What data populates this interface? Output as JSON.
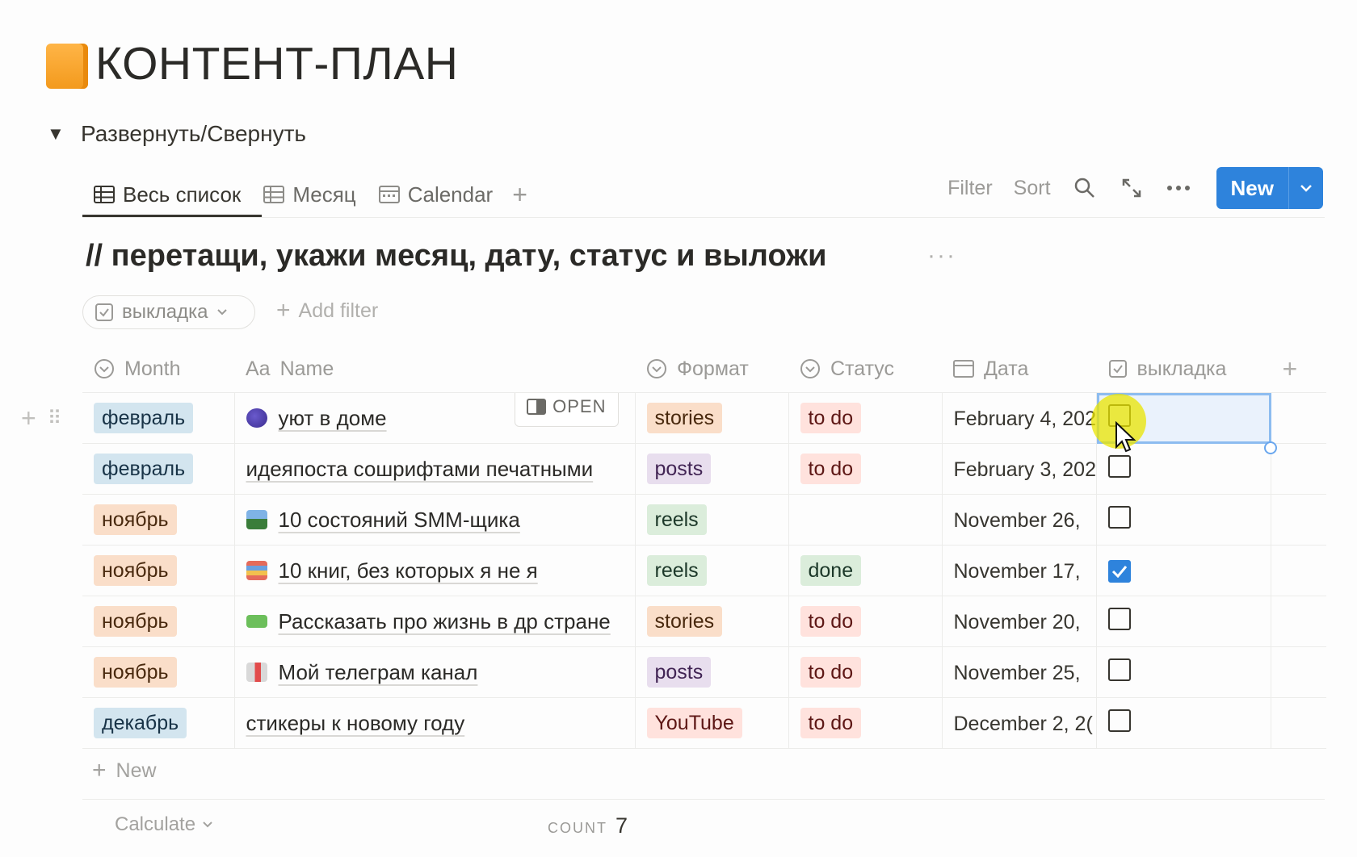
{
  "page": {
    "title": "КОНТЕНТ-ПЛАН",
    "icon": "orange-notebook-icon",
    "toggle_label": "Развернуть/Свернуть"
  },
  "tabs": [
    {
      "label": "Весь список",
      "icon": "table-icon",
      "active": true
    },
    {
      "label": "Месяц",
      "icon": "table-icon",
      "active": false
    },
    {
      "label": "Calendar",
      "icon": "calendar-icon",
      "active": false
    }
  ],
  "toolbar": {
    "filter": "Filter",
    "sort": "Sort",
    "new_label": "New",
    "accent": "#2e83dc"
  },
  "view": {
    "title": "// перетащи, укажи месяц, дату, статус и выложи",
    "filter_pill": "выкладка",
    "add_filter": "Add filter"
  },
  "columns": {
    "month": "Month",
    "name_prefix": "Aa",
    "name": "Name",
    "format": "Формат",
    "status": "Статус",
    "date": "Дата",
    "posted": "выкладка"
  },
  "rows": [
    {
      "month": "февраль",
      "month_color": "blue",
      "emoji": "grapes",
      "name": "уют в доме",
      "format": "stories",
      "format_color": "orange",
      "status": "to do",
      "date": "February 4, 202",
      "posted": false
    },
    {
      "month": "февраль",
      "month_color": "blue",
      "emoji": "",
      "name": "идеяпоста сошрифтами печатными",
      "format": "posts",
      "format_color": "purple",
      "status": "to do",
      "date": "February 3, 202",
      "posted": false
    },
    {
      "month": "ноябрь",
      "month_color": "orange",
      "emoji": "landscape",
      "name": "10 состояний SMM-щика",
      "format": "reels",
      "format_color": "green",
      "status": "",
      "date": "November 26,",
      "posted": false
    },
    {
      "month": "ноябрь",
      "month_color": "orange",
      "emoji": "books",
      "name": "10 книг, без которых я не я",
      "format": "reels",
      "format_color": "green",
      "status": "done",
      "date": "November 17,",
      "posted": true
    },
    {
      "month": "ноябрь",
      "month_color": "orange",
      "emoji": "banknote",
      "name": "Рассказать про жизнь в др стране",
      "format": "stories",
      "format_color": "orange",
      "status": "to do",
      "date": "November 20,",
      "posted": false
    },
    {
      "month": "ноябрь",
      "month_color": "orange",
      "emoji": "bookmark",
      "name": "Мой телеграм канал",
      "format": "posts",
      "format_color": "purple",
      "status": "to do",
      "date": "November 25,",
      "posted": false
    },
    {
      "month": "декабрь",
      "month_color": "blue",
      "emoji": "",
      "name": "стикеры к новому году",
      "format": "YouTube",
      "format_color": "red",
      "status": "to do",
      "date": "December 2, 2(",
      "posted": false
    }
  ],
  "row_open_label": "OPEN",
  "footer": {
    "new_row": "New",
    "calculate": "Calculate",
    "count_label": "COUNT",
    "count_value": "7"
  }
}
